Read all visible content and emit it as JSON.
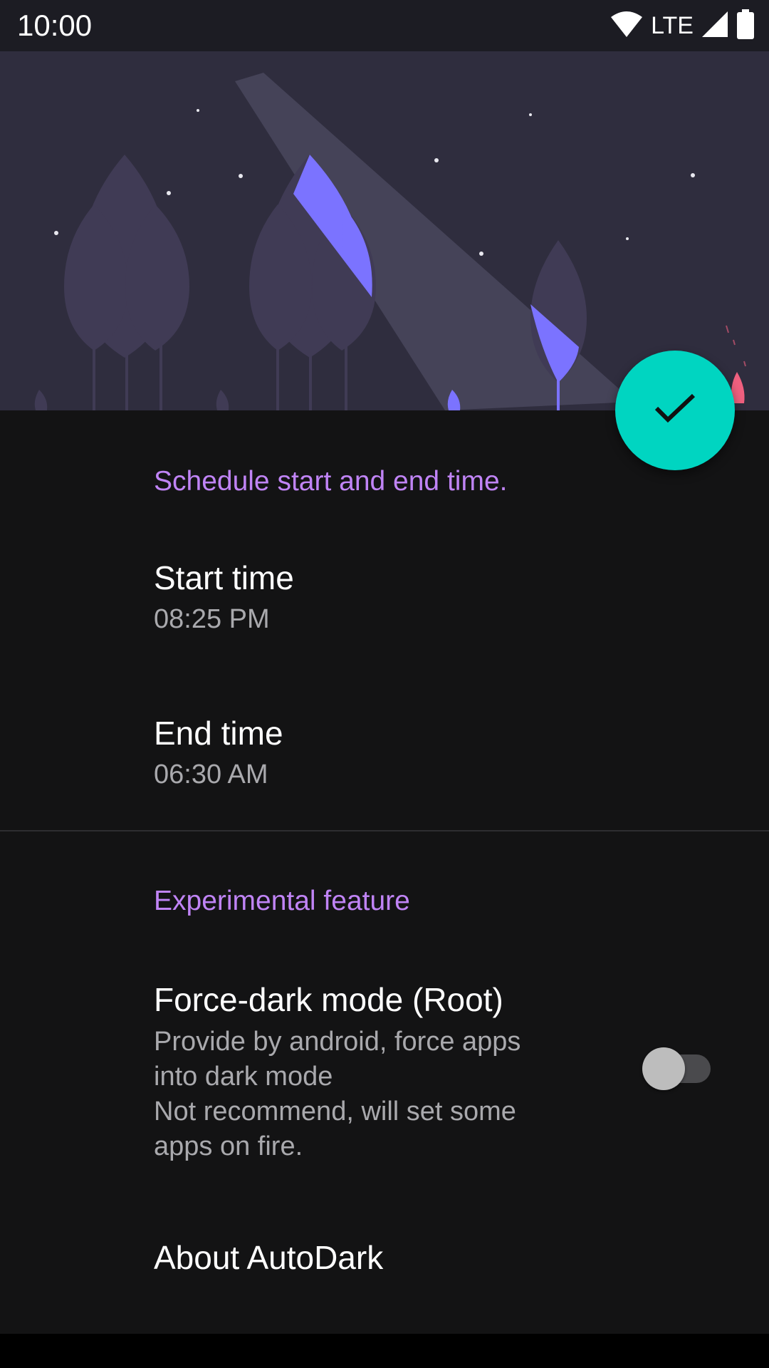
{
  "status_bar": {
    "time": "10:00",
    "network": "LTE",
    "icons": [
      "wifi-icon",
      "cell-signal-icon",
      "battery-icon"
    ]
  },
  "header": {
    "illustration": "night-forest-moonbeam"
  },
  "fab": {
    "icon": "check-icon",
    "color": "#00d5c1"
  },
  "schedule": {
    "section_title": "Schedule start and end time.",
    "start_time": {
      "title": "Start time",
      "value": "08:25 PM"
    },
    "end_time": {
      "title": "End time",
      "value": "06:30 AM"
    }
  },
  "experimental": {
    "section_title": "Experimental feature",
    "force_dark": {
      "title": "Force-dark mode (Root)",
      "summary_line1": "Provide by android, force apps",
      "summary_line2": "into dark mode",
      "summary_line3": "Not recommend, will set some",
      "summary_line4": "apps on fire.",
      "enabled": false
    },
    "about": {
      "title": "About AutoDark"
    }
  },
  "colors": {
    "accent": "#c084f6",
    "fab": "#00d5c1",
    "header_bg": "#2f2d3e",
    "leaf_highlight": "#7b73ff",
    "background": "#131314"
  }
}
